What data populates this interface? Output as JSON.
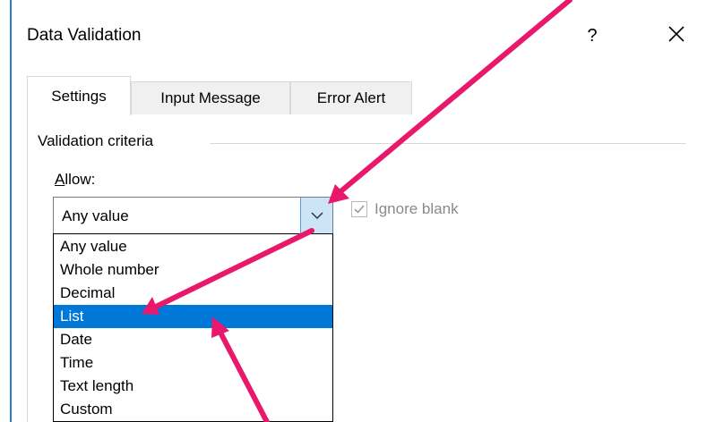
{
  "dialog": {
    "title": "Data Validation",
    "help_label": "?",
    "close_icon": "close-icon"
  },
  "tabs": [
    {
      "label": "Settings",
      "active": true
    },
    {
      "label": "Input Message",
      "active": false
    },
    {
      "label": "Error Alert",
      "active": false
    }
  ],
  "settings": {
    "group_label": "Validation criteria",
    "allow_label_first": "A",
    "allow_label_rest": "llow:",
    "allow_value": "Any value",
    "ignore_blank_label": "Ignore blank",
    "ignore_blank_checked": true,
    "allow_options": [
      "Any value",
      "Whole number",
      "Decimal",
      "List",
      "Date",
      "Time",
      "Text length",
      "Custom"
    ],
    "highlighted_option": "List"
  },
  "colors": {
    "annotation_arrow": "#e8196b",
    "selection": "#0078d7",
    "dropdown_button": "#cce4f7"
  }
}
